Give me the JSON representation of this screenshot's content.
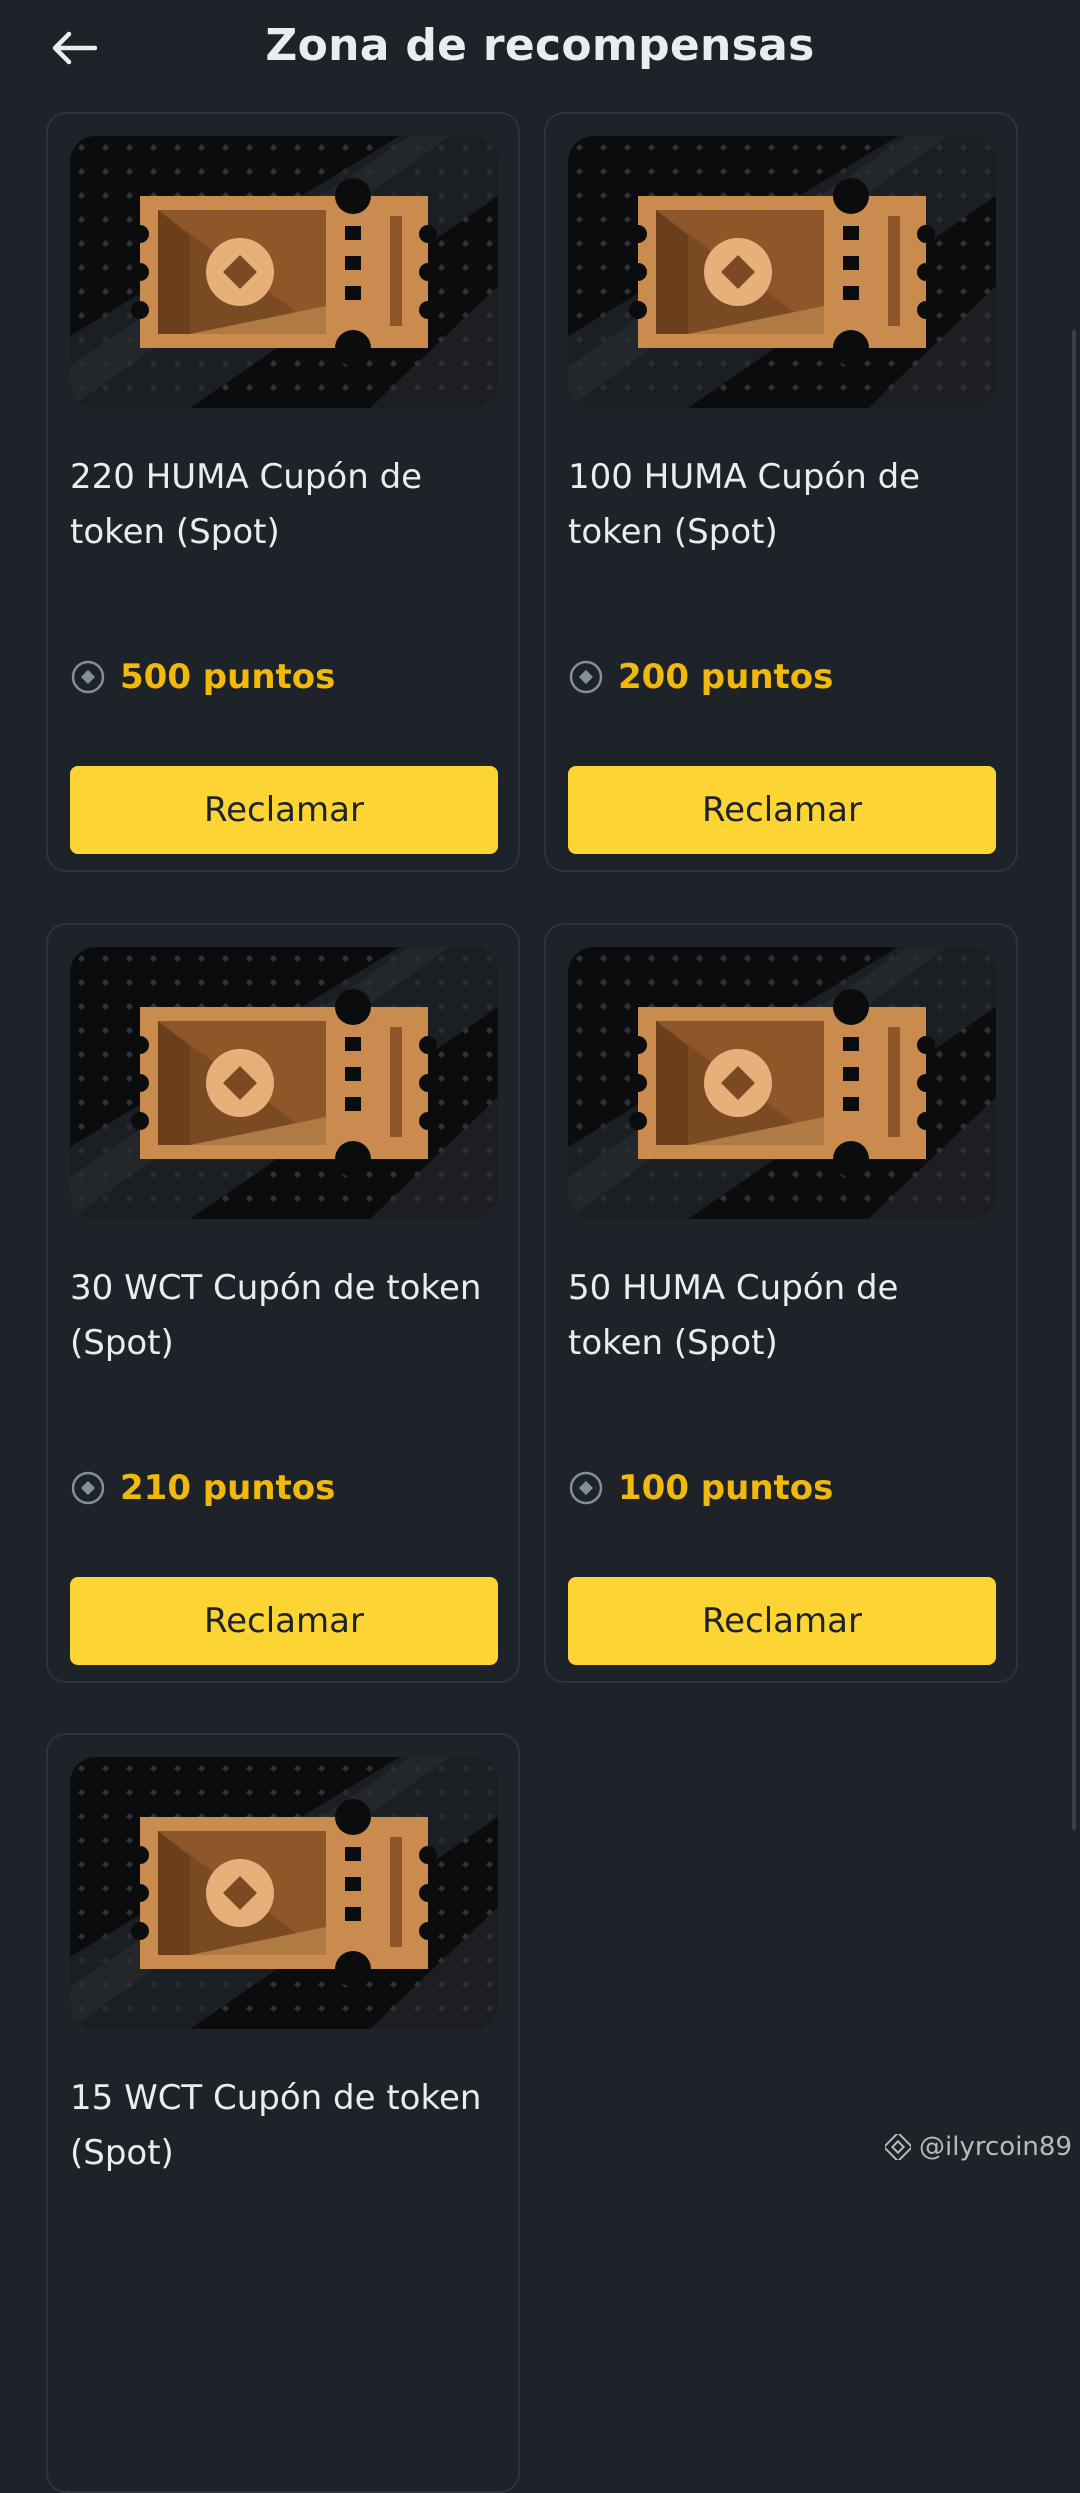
{
  "header": {
    "title": "Zona de recompensas"
  },
  "cards": [
    {
      "title": "220 HUMA Cupón de token (Spot)",
      "points": "500 puntos",
      "button": "Reclamar"
    },
    {
      "title": "100 HUMA Cupón de token (Spot)",
      "points": "200 puntos",
      "button": "Reclamar"
    },
    {
      "title": "30 WCT Cupón de token (Spot)",
      "points": "210 puntos",
      "button": "Reclamar"
    },
    {
      "title": "50 HUMA Cupón de token (Spot)",
      "points": "100 puntos",
      "button": "Reclamar"
    },
    {
      "title": "15 WCT Cupón de token (Spot)",
      "points": "",
      "button": ""
    }
  ],
  "watermark": {
    "text": "@ilyrcoin89"
  },
  "colors": {
    "background": "#1e2329",
    "accent": "#fcd535",
    "points": "#f0b90b",
    "ticket": "#c98b4e"
  }
}
